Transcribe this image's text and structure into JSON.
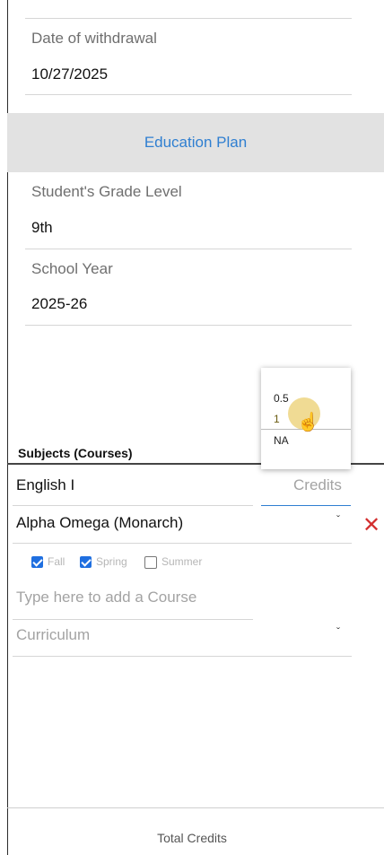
{
  "withdrawal": {
    "label": "Date of withdrawal",
    "value": "10/27/2025"
  },
  "banner": {
    "title": "Education Plan"
  },
  "grade": {
    "label": "Student's Grade Level",
    "value": "9th"
  },
  "school_year": {
    "label": "School Year",
    "value": "2025-26"
  },
  "credits_dropdown": {
    "options": [
      "0.5",
      "1",
      "NA"
    ],
    "hovered": "1"
  },
  "subjects": {
    "title": "Subjects (Courses)",
    "course": {
      "name": "English I",
      "credits_placeholder": "Credits",
      "curriculum": "Alpha Omega (Monarch)",
      "terms": [
        {
          "label": "Fall",
          "checked": true
        },
        {
          "label": "Spring",
          "checked": true
        },
        {
          "label": "Summer",
          "checked": false
        }
      ]
    },
    "new_course": {
      "placeholder": "Type here to add a Course",
      "curriculum_placeholder": "Curriculum"
    }
  },
  "footer": {
    "total_label": "Total Credits"
  },
  "colors": {
    "accent": "#2f7fd1",
    "remove": "#d32f2f",
    "checkbox": "#1f6fe0",
    "hover": "#e8c85a"
  },
  "icons": {
    "remove": "close-icon",
    "dropdown": "chevron-down-icon",
    "pointer": "hand-pointer-icon"
  }
}
